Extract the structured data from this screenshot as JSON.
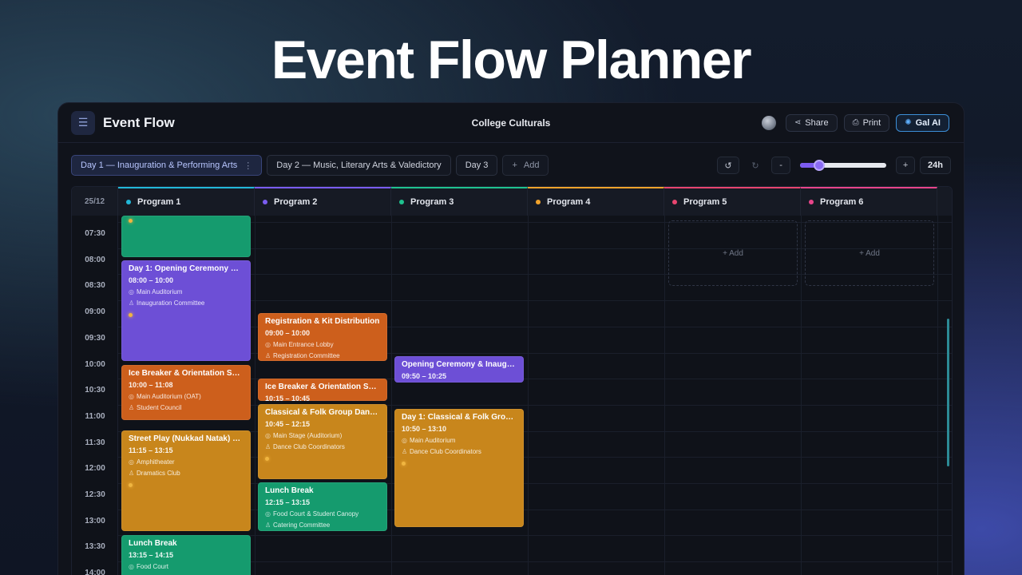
{
  "hero": {
    "title": "Event Flow Planner"
  },
  "app": {
    "brand": "Event Flow",
    "doc_title": "College Culturals",
    "actions": {
      "share": "Share",
      "print": "Print",
      "ai": "Gal AI"
    }
  },
  "tabs": {
    "days": [
      {
        "label": "Day 1 — Inauguration & Performing Arts",
        "active": true
      },
      {
        "label": "Day 2 — Music, Literary Arts & Valedictory",
        "active": false
      },
      {
        "label": "Day 3",
        "active": false
      }
    ],
    "add_label": "Add",
    "zoom": {
      "minus": "-",
      "plus": "+",
      "label": "24h",
      "level": 0.22
    }
  },
  "grid": {
    "date": "25/12",
    "programs": [
      {
        "name": "Program 1",
        "color": "#22b7d8"
      },
      {
        "name": "Program 2",
        "color": "#7a5cf0"
      },
      {
        "name": "Program 3",
        "color": "#1fc28f"
      },
      {
        "name": "Program 4",
        "color": "#f0a22b"
      },
      {
        "name": "Program 5",
        "color": "#e8456f"
      },
      {
        "name": "Program 6",
        "color": "#e8458a"
      }
    ],
    "times": [
      "07:30",
      "08:00",
      "08:30",
      "09:00",
      "09:30",
      "10:00",
      "10:30",
      "11:00",
      "11:30",
      "12:00",
      "12:30",
      "13:00",
      "13:30",
      "14:00"
    ],
    "add_slot_label": "+ Add"
  },
  "events": [
    {
      "title": "",
      "time": "",
      "location": "",
      "organizer": ""
    },
    {
      "title": "Day 1: Opening Ceremony & In...",
      "time": "08:00 – 10:00",
      "location": "Main Auditorium",
      "organizer": "Inauguration Committee"
    },
    {
      "title": "Ice Breaker & Orientation Sess...",
      "time": "10:00 – 11:08",
      "location": "Main Auditorium (OAT)",
      "organizer": "Student Council"
    },
    {
      "title": "Street Play (Nukkad Natak) Co...",
      "time": "11:15 – 13:15",
      "location": "Amphitheater",
      "organizer": "Dramatics Club"
    },
    {
      "title": "Lunch Break",
      "time": "13:15 – 14:15",
      "location": "Food Court",
      "organizer": ""
    },
    {
      "title": "Registration & Kit Distribution",
      "time": "09:00 – 10:00",
      "location": "Main Entrance Lobby",
      "organizer": "Registration Committee"
    },
    {
      "title": "Ice Breaker & Orientation Sess...",
      "time": "10:15 – 10:45",
      "location": "",
      "organizer": ""
    },
    {
      "title": "Classical & Folk Group Dance ...",
      "time": "10:45 – 12:15",
      "location": "Main Stage (Auditorium)",
      "organizer": "Dance Club Coordinators"
    },
    {
      "title": "Lunch Break",
      "time": "12:15 – 13:15",
      "location": "Food Court & Student Canopy",
      "organizer": "Catering Committee"
    },
    {
      "title": "Opening Ceremony & Inaugur...",
      "time": "09:50 – 10:25",
      "location": "",
      "organizer": ""
    },
    {
      "title": "Day 1: Classical & Folk Group D...",
      "time": "10:50 – 13:10",
      "location": "Main Auditorium",
      "organizer": "Dance Club Coordinators"
    }
  ]
}
